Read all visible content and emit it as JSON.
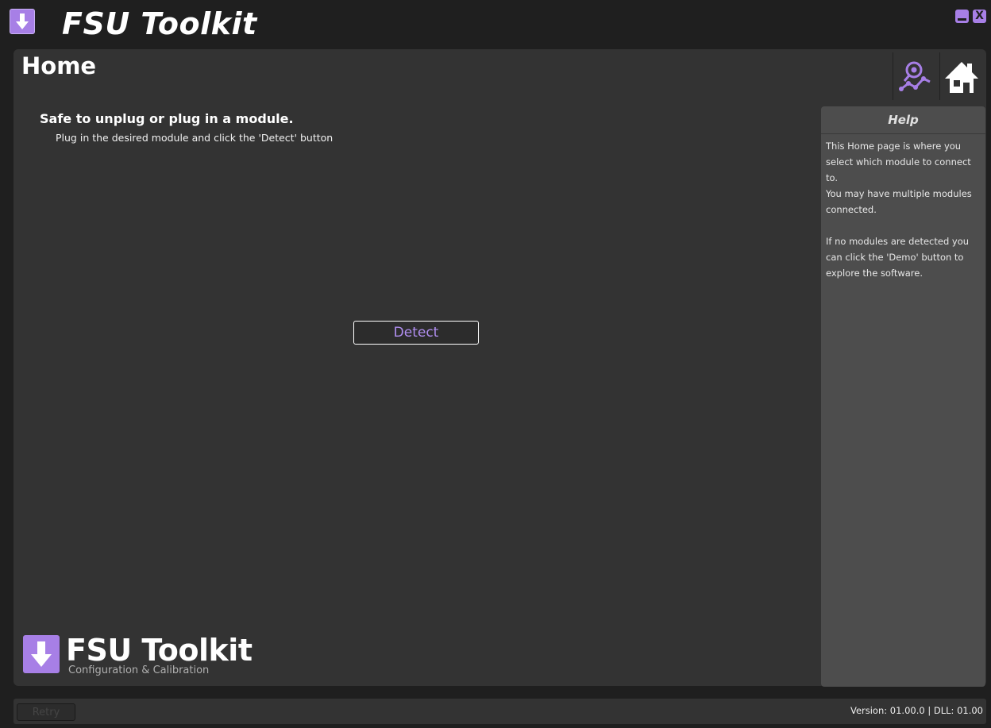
{
  "window": {
    "title": "FSU Toolkit",
    "icon": "usb-download-icon",
    "controls": {
      "minimize_icon": "minimize-icon",
      "close_icon": "close-icon",
      "close_glyph": "X"
    }
  },
  "page": {
    "title": "Home",
    "toolbar": {
      "analytics_icon": "analytics-icon",
      "home_icon": "home-icon"
    }
  },
  "status": {
    "heading": "Safe to unplug or plug in a module.",
    "subtext": "Plug in the desired module and click the 'Detect' button"
  },
  "detect_button": {
    "label": "Detect"
  },
  "help": {
    "title": "Help",
    "paragraphs": [
      "This Home page is where you select which module to connect to.",
      "You may have multiple modules connected.",
      "If no modules are detected you can click the 'Demo' button to explore the software."
    ]
  },
  "logo": {
    "name": "FSU Toolkit",
    "tagline": "Configuration & Calibration"
  },
  "footer": {
    "retry_label": "Retry",
    "version_text": "Version: 01.00.0 | DLL: 01.00"
  },
  "colors": {
    "accent": "#a77fe6",
    "detect_text": "#b08ef0",
    "panel": "#333333",
    "background": "#1f1f1f",
    "help_panel": "#4d4d4d"
  }
}
